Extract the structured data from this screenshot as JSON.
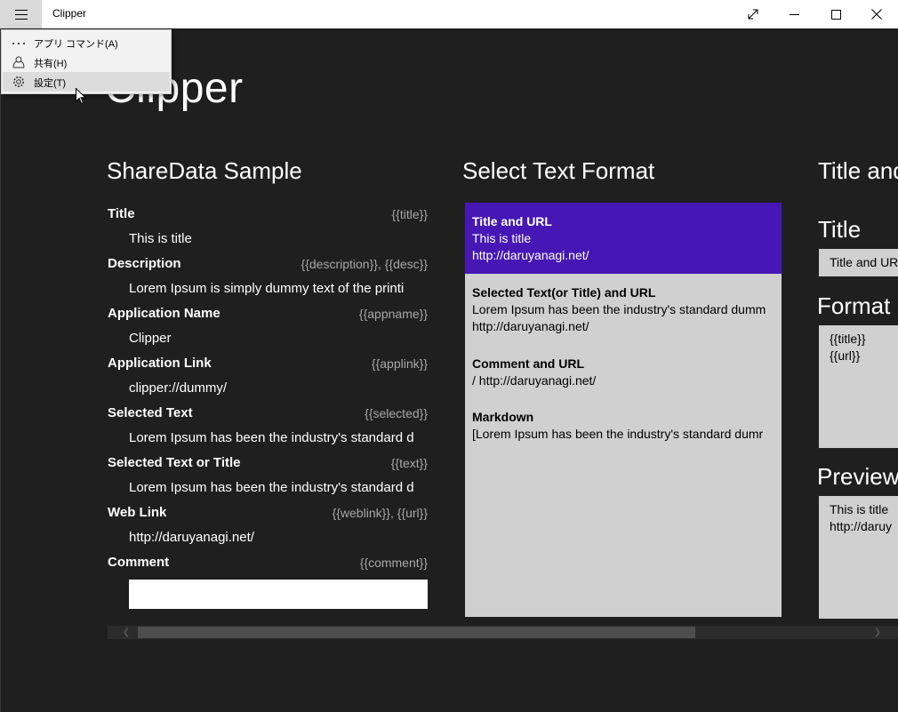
{
  "window": {
    "title": "Clipper"
  },
  "page": {
    "title": "Clipper"
  },
  "menu": {
    "items": [
      {
        "label": "アプリ コマンド(A)",
        "icon": "more-icon"
      },
      {
        "label": "共有(H)",
        "icon": "share-icon"
      },
      {
        "label": "設定(T)",
        "icon": "gear-icon"
      }
    ]
  },
  "sharedata": {
    "title": "ShareData Sample",
    "rows": [
      {
        "label": "Title",
        "tag": "{{title}}",
        "value": "This is title"
      },
      {
        "label": "Description",
        "tag": "{{description}}, {{desc}}",
        "value": "Lorem Ipsum is simply dummy text of the printi"
      },
      {
        "label": "Application Name",
        "tag": "{{appname}}",
        "value": "Clipper"
      },
      {
        "label": "Application Link",
        "tag": "{{applink}}",
        "value": "clipper://dummy/"
      },
      {
        "label": "Selected Text",
        "tag": "{{selected}}",
        "value": "Lorem Ipsum has been the industry's standard d"
      },
      {
        "label": "Selected Text or Title",
        "tag": "{{text}}",
        "value": "Lorem Ipsum has been the industry's standard d"
      },
      {
        "label": "Web Link",
        "tag": "{{weblink}}, {{url}}",
        "value": "http://daruyanagi.net/"
      },
      {
        "label": "Comment",
        "tag": "{{comment}}",
        "value": ""
      }
    ]
  },
  "formats": {
    "title": "Select Text Format",
    "items": [
      {
        "title": "Title and URL",
        "line1": "This is title",
        "line2": "http://daruyanagi.net/"
      },
      {
        "title": "Selected Text(or Title) and URL",
        "line1": "Lorem Ipsum has been the industry's standard dumm",
        "line2": "http://daruyanagi.net/"
      },
      {
        "title": "Comment and URL",
        "line1": " / http://daruyanagi.net/",
        "line2": ""
      },
      {
        "title": "Markdown",
        "line1": "[Lorem Ipsum has been the industry's standard dumr",
        "line2": ""
      }
    ]
  },
  "detail": {
    "title": "Title and",
    "title_label": "Title",
    "title_value": "Title and UR",
    "format_label": "Format",
    "format_line1": "{{title}}",
    "format_line2": "{{url}}",
    "preview_label": "Preview",
    "preview_line1": "This is title",
    "preview_line2": "http://daruy"
  },
  "colors": {
    "accent": "#4617b4",
    "background": "#1f1f1f",
    "panel": "#d0d0d0"
  }
}
